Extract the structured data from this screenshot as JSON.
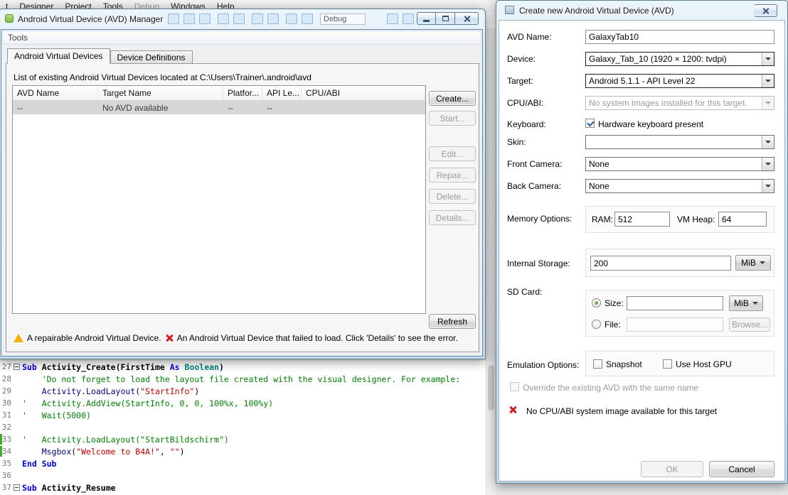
{
  "ide": {
    "menus": [
      {
        "label": "t",
        "disabled": false
      },
      {
        "label": "Designer",
        "disabled": false
      },
      {
        "label": "Project",
        "disabled": false
      },
      {
        "label": "Tools",
        "disabled": false
      },
      {
        "label": "Debug",
        "disabled": true
      },
      {
        "label": "Windows",
        "disabled": false
      },
      {
        "label": "Help",
        "disabled": false
      }
    ],
    "toolbar_combo_label": "Debug",
    "editor": {
      "lines": [
        {
          "num": "27",
          "fold": true,
          "bold": true,
          "mark": false,
          "segments": [
            [
              "kw",
              "Sub "
            ],
            [
              "name",
              "Activity_Create"
            ],
            [
              "pl",
              "(FirstTime "
            ],
            [
              "kw",
              "As "
            ],
            [
              "type",
              "Boolean"
            ],
            [
              "pl",
              ")"
            ]
          ]
        },
        {
          "num": "28",
          "segments": [
            [
              "cm",
              "    'Do not forget to load the layout file created with the visual designer. For example:"
            ]
          ]
        },
        {
          "num": "29",
          "segments": [
            [
              "pl",
              "    "
            ],
            [
              "mem",
              "Activity.LoadLayout"
            ],
            [
              "pl",
              "("
            ],
            [
              "str",
              "\"StartInfo\""
            ],
            [
              "pl",
              ")"
            ]
          ]
        },
        {
          "num": "30",
          "segments": [
            [
              "cm",
              "'   Activity.AddView(StartInfo, 0, 0, 100%x, 100%y)"
            ]
          ]
        },
        {
          "num": "31",
          "segments": [
            [
              "cm",
              "'   Wait(5000)"
            ]
          ]
        },
        {
          "num": "32",
          "segments": []
        },
        {
          "num": "33",
          "mark": true,
          "segments": [
            [
              "cm",
              "'   Activity.LoadLayout(\"StartBildschirm\")"
            ]
          ]
        },
        {
          "num": "34",
          "mark": true,
          "segments": [
            [
              "pl",
              "    "
            ],
            [
              "mem",
              "Msgbox"
            ],
            [
              "pl",
              "("
            ],
            [
              "str",
              "\"Welcome to B4A!\""
            ],
            [
              "pl",
              ", "
            ],
            [
              "str",
              "\"\""
            ],
            [
              "pl",
              ")"
            ]
          ]
        },
        {
          "num": "35",
          "segments": [
            [
              "kw",
              "End Sub"
            ]
          ]
        },
        {
          "num": "36",
          "segments": []
        },
        {
          "num": "37",
          "fold": true,
          "bold": true,
          "segments": [
            [
              "kw",
              "Sub "
            ],
            [
              "name",
              "Activity_Resume"
            ]
          ]
        }
      ]
    }
  },
  "avd_manager": {
    "title": "Android Virtual Device (AVD) Manager",
    "menu": "Tools",
    "tabs": [
      "Android Virtual Devices",
      "Device Definitions"
    ],
    "list_label": "List of existing Android Virtual Devices located at C:\\Users\\Trainer\\.android\\avd",
    "table": {
      "columns": [
        "AVD Name",
        "Target Name",
        "Platfor...",
        "API Le...",
        "CPU/ABI"
      ],
      "rows": [
        [
          "--",
          "No AVD available",
          "--",
          "--",
          ""
        ]
      ]
    },
    "buttons": [
      {
        "label": "Create...",
        "enabled": true
      },
      {
        "label": "Start...",
        "enabled": false
      },
      {
        "label": "Edit...",
        "enabled": false
      },
      {
        "label": "Repair...",
        "enabled": false
      },
      {
        "label": "Delete...",
        "enabled": false
      },
      {
        "label": "Details...",
        "enabled": false
      },
      {
        "label": "Refresh",
        "enabled": true
      }
    ],
    "legend": {
      "warning": "A repairable Android Virtual Device.",
      "error": "An Android Virtual Device that failed to load. Click 'Details' to see the error."
    }
  },
  "create_dialog": {
    "title": "Create new Android Virtual Device (AVD)",
    "fields": {
      "avd_name": {
        "label": "AVD Name:",
        "value": "GalaxyTab10"
      },
      "device": {
        "label": "Device:",
        "value": "Galaxy_Tab_10 (1920 × 1200: tvdpi)"
      },
      "target": {
        "label": "Target:",
        "value": "Android 5.1.1 - API Level 22"
      },
      "cpu_abi": {
        "label": "CPU/ABI:",
        "value": "No system images installed for this target."
      },
      "keyboard": {
        "label": "Keyboard:",
        "option": "Hardware keyboard present",
        "checked": true
      },
      "skin": {
        "label": "Skin:",
        "value": ""
      },
      "front_camera": {
        "label": "Front Camera:",
        "value": "None"
      },
      "back_camera": {
        "label": "Back Camera:",
        "value": "None"
      },
      "memory": {
        "label": "Memory Options:",
        "ram_label": "RAM:",
        "ram_value": "512",
        "vm_label": "VM Heap:",
        "vm_value": "64"
      },
      "storage": {
        "label": "Internal Storage:",
        "value": "200",
        "unit": "MiB"
      },
      "sd_card": {
        "label": "SD Card:",
        "size_label": "Size:",
        "size_value": "",
        "size_unit": "MiB",
        "file_label": "File:",
        "file_value": "",
        "browse_label": "Browse..."
      },
      "emulation": {
        "label": "Emulation Options:",
        "snapshot": "Snapshot",
        "host_gpu": "Use Host GPU"
      },
      "override_label": "Override the existing AVD with the same name",
      "error": "No CPU/ABI system image available for this target"
    },
    "buttons": {
      "ok": "OK",
      "cancel": "Cancel"
    }
  }
}
